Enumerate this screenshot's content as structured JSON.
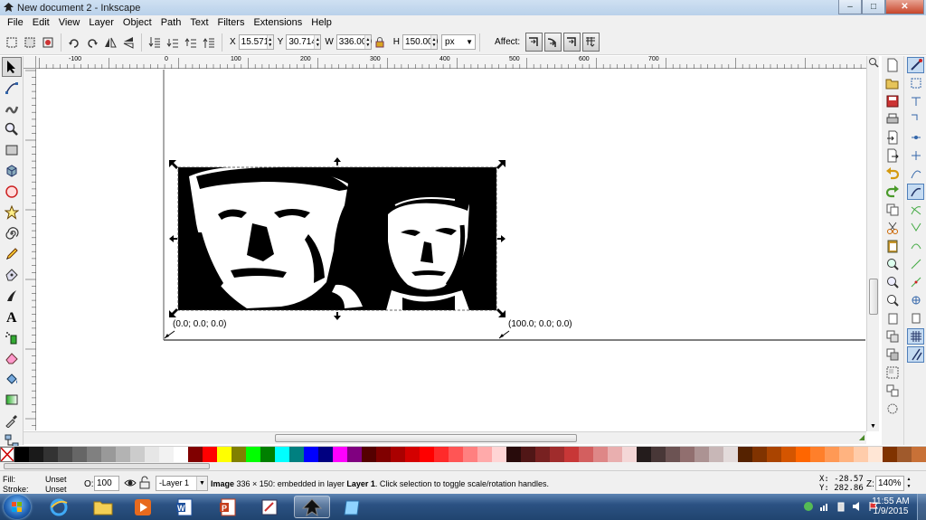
{
  "window": {
    "title": "New document 2 - Inkscape",
    "minimize": "–",
    "maximize": "□",
    "close": "✕"
  },
  "menu": [
    "File",
    "Edit",
    "View",
    "Layer",
    "Object",
    "Path",
    "Text",
    "Filters",
    "Extensions",
    "Help"
  ],
  "toolbar": {
    "x_label": "X",
    "x_value": "15.571",
    "y_label": "Y",
    "y_value": "30.714",
    "w_label": "W",
    "w_value": "336.000",
    "h_label": "H",
    "h_value": "150.000",
    "unit": "px",
    "affect_label": "Affect:"
  },
  "ruler": {
    "h_labels": [
      "-100",
      "0",
      "100",
      "200",
      "300",
      "400",
      "500",
      "600",
      "700"
    ]
  },
  "canvas": {
    "image_label": "Image",
    "origin_label": "(0.0; 0.0; 0.0)",
    "end_label": "(100.0; 0.0; 0.0)"
  },
  "palette_colors": [
    "#000000",
    "#1a1a1a",
    "#333333",
    "#4d4d4d",
    "#666666",
    "#808080",
    "#999999",
    "#b3b3b3",
    "#cccccc",
    "#e6e6e6",
    "#f2f2f2",
    "#ffffff",
    "#800000",
    "#ff0000",
    "#ffff00",
    "#808000",
    "#00ff00",
    "#008000",
    "#00ffff",
    "#008080",
    "#0000ff",
    "#000080",
    "#ff00ff",
    "#800080",
    "#550000",
    "#800000",
    "#aa0000",
    "#d40000",
    "#ff0000",
    "#ff2a2a",
    "#ff5555",
    "#ff8080",
    "#ffaaaa",
    "#ffd5d5",
    "#280b0b",
    "#501616",
    "#782121",
    "#a02c2c",
    "#c83737",
    "#d35f5f",
    "#de8787",
    "#e9afaf",
    "#f4d7d7",
    "#241c1c",
    "#483737",
    "#6c5353",
    "#916f6f",
    "#ac9393",
    "#c8b7b7",
    "#e3dbdb",
    "#552200",
    "#803300",
    "#aa4400",
    "#d45500",
    "#ff6600",
    "#ff7f2a",
    "#ff9955",
    "#ffb380",
    "#ffccaa",
    "#ffe6d5",
    "#803300",
    "#a05a2c",
    "#c87137"
  ],
  "status": {
    "fill_label": "Fill:",
    "fill_value": "Unset",
    "stroke_label": "Stroke:",
    "stroke_value": "Unset",
    "opacity_label": "O:",
    "opacity_value": "100",
    "layer": "-Layer 1",
    "message_strong": "Image",
    "message_main": " 336 × 150: embedded in layer ",
    "message_layer": "Layer 1",
    "message_tail": ". Click selection to toggle scale/rotation handles.",
    "x_coord": "X:  -28.57",
    "y_coord": "Y:  282.86",
    "zoom_label": "Z:",
    "zoom_value": "140%"
  },
  "taskbar": {
    "time": "11:55 AM",
    "date": "1/9/2015"
  }
}
